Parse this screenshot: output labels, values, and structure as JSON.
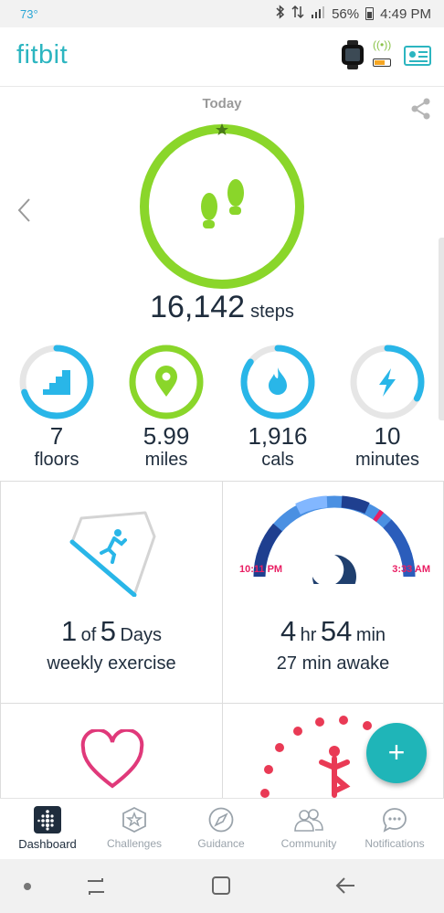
{
  "status_bar": {
    "temperature": "73°",
    "battery_percent": "56%",
    "time": "4:49 PM"
  },
  "app_bar": {
    "logo": "fitbit",
    "device_battery_level": 0.6
  },
  "hero": {
    "day_label": "Today",
    "steps_value": "16,142",
    "steps_unit": "steps",
    "goal_progress": 1.0
  },
  "stats": [
    {
      "value": "7",
      "unit": "floors",
      "icon": "stairs-icon",
      "color": "#29b6e8",
      "progress": 0.7
    },
    {
      "value": "5.99",
      "unit": "miles",
      "icon": "location-pin-icon",
      "color": "#8ad62a",
      "progress": 1.0
    },
    {
      "value": "1,916",
      "unit": "cals",
      "icon": "flame-icon",
      "color": "#29b6e8",
      "progress": 0.85
    },
    {
      "value": "10",
      "unit": "minutes",
      "icon": "lightning-icon",
      "color": "#29b6e8",
      "progress": 0.33
    }
  ],
  "exercise_tile": {
    "count": "1",
    "of_word": "of",
    "target": "5",
    "days_word": "Days",
    "caption": "weekly exercise"
  },
  "sleep_tile": {
    "hours": "4",
    "hr_unit": "hr",
    "minutes": "54",
    "min_unit": "min",
    "awake": "27 min awake",
    "start_time": "10:11 PM",
    "end_time": "3:33 AM"
  },
  "fab": {
    "label": "+"
  },
  "colors": {
    "accent": "#2cb5c0",
    "lime": "#8ad62a",
    "blue": "#29b6e8",
    "pink": "#e91e63",
    "navy": "#1f2d3d"
  },
  "bottom_nav": [
    {
      "label": "Dashboard",
      "icon": "dashboard-icon",
      "active": true
    },
    {
      "label": "Challenges",
      "icon": "challenges-star-icon",
      "active": false
    },
    {
      "label": "Guidance",
      "icon": "compass-icon",
      "active": false
    },
    {
      "label": "Community",
      "icon": "community-people-icon",
      "active": false
    },
    {
      "label": "Notifications",
      "icon": "chat-bubble-icon",
      "active": false
    }
  ]
}
